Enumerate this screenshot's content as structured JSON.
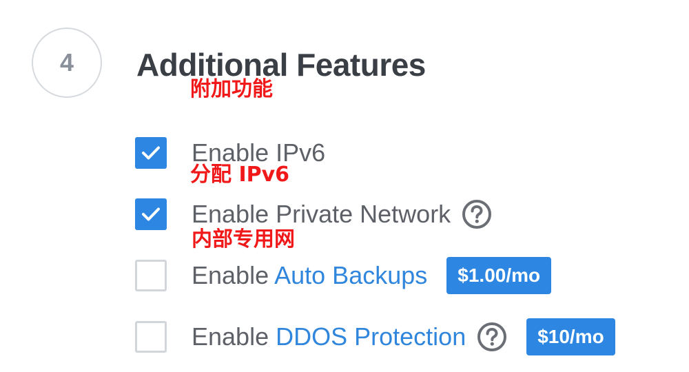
{
  "section": {
    "step_number": "4",
    "title": "Additional Features",
    "title_annotation": "附加功能"
  },
  "features": [
    {
      "prefix": "Enable ",
      "name": "IPv6",
      "checked": true,
      "annotation": "分配 IPv6"
    },
    {
      "prefix": "Enable ",
      "name": "Private Network",
      "checked": true,
      "has_help_icon": true,
      "help_icon": "question-circle-icon",
      "annotation": "内部专用网"
    },
    {
      "prefix": "Enable ",
      "link_text": "Auto Backups",
      "checked": false,
      "price": "$1.00/mo"
    },
    {
      "prefix": "Enable ",
      "link_text": "DDOS Protection",
      "checked": false,
      "has_help_icon": true,
      "help_icon": "question-circle-icon",
      "price": "$10/mo"
    }
  ],
  "colors": {
    "accent": "#2d87e2",
    "link": "#2f86dc",
    "annotation": "#f01818",
    "text": "#5d6167",
    "title": "#3a3e45"
  }
}
